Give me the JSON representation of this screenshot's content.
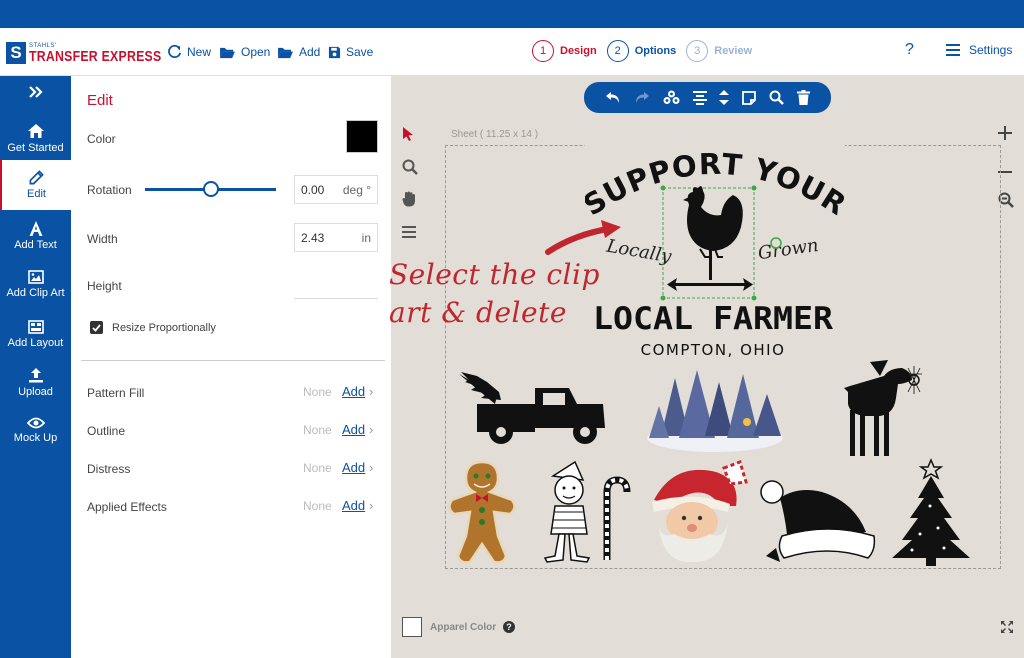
{
  "app": {
    "logo_small": "STAHLS'",
    "logo_main": "TRANSFER EXPRESS",
    "logo_letter": "S"
  },
  "toolbar": {
    "new_label": "New",
    "open_label": "Open",
    "add_label": "Add",
    "save_label": "Save",
    "help_label": "?",
    "settings_label": "Settings"
  },
  "steps": [
    {
      "num": "1",
      "label": "Design",
      "color": "#c8102e"
    },
    {
      "num": "2",
      "label": "Options",
      "color": "#0a52a3"
    },
    {
      "num": "3",
      "label": "Review",
      "color": "#9ab3d6"
    }
  ],
  "nav": {
    "collapse_icon": "double-chevron-right-icon",
    "items": [
      {
        "label": "Get Started",
        "icon": "home-icon"
      },
      {
        "label": "Edit",
        "icon": "pencil-icon"
      },
      {
        "label": "Add Text",
        "icon": "text-a-icon"
      },
      {
        "label": "Add Clip Art",
        "icon": "image-icon"
      },
      {
        "label": "Add Layout",
        "icon": "layout-icon"
      },
      {
        "label": "Upload",
        "icon": "upload-icon"
      },
      {
        "label": "Mock Up",
        "icon": "eye-icon"
      }
    ]
  },
  "edit": {
    "title": "Edit",
    "color_label": "Color",
    "color_value": "#000000",
    "rotation_label": "Rotation",
    "rotation_value": "0.00",
    "rotation_unit": "deg °",
    "rotation_fraction": 0.5,
    "width_label": "Width",
    "width_value": "2.43",
    "width_unit": "in",
    "height_label": "Height",
    "resize_label": "Resize Proportionally",
    "resize_checked": true,
    "effects": [
      {
        "label": "Pattern Fill",
        "value": "None",
        "action": "Add"
      },
      {
        "label": "Outline",
        "value": "None",
        "action": "Add"
      },
      {
        "label": "Distress",
        "value": "None",
        "action": "Add"
      },
      {
        "label": "Applied Effects",
        "value": "None",
        "action": "Add"
      }
    ]
  },
  "canvas": {
    "sheet_label": "Sheet ( 11.25 x 14 )",
    "design_line1": "SUPPORT YOUR",
    "design_locally": "Locally",
    "design_grown": "Grown",
    "design_line2": "LOCAL FARMER",
    "design_line3": "COMPTON, OHIO",
    "annotation_line1": "Select the clip",
    "annotation_line2": "art & delete",
    "apparel_label": "Apparel Color",
    "apparel_help": "?",
    "background": "#e2ddd6"
  }
}
